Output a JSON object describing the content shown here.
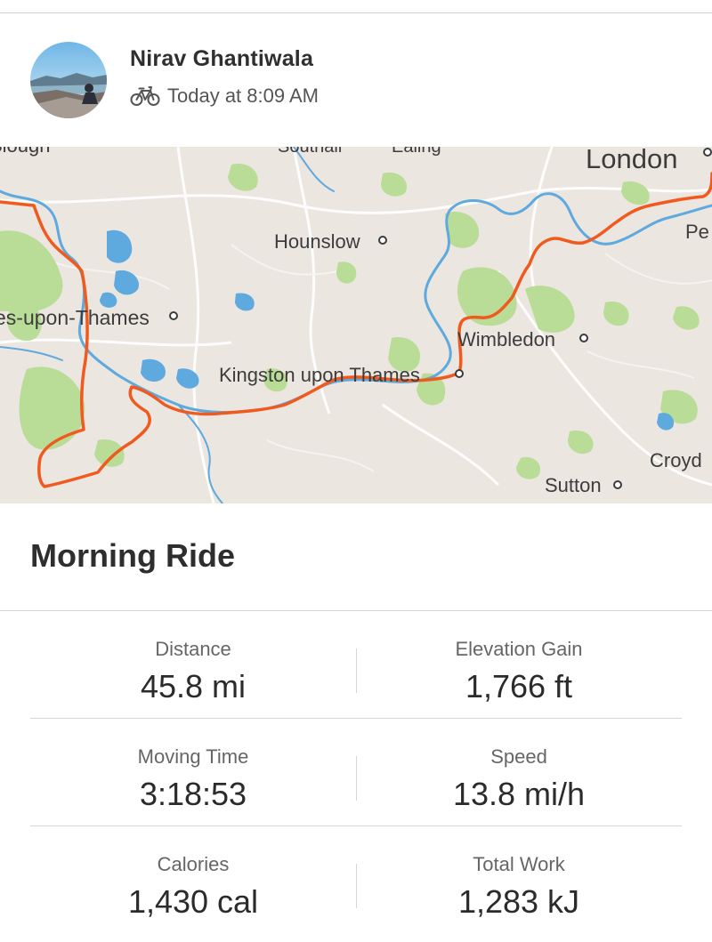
{
  "header": {
    "athlete_name": "Nirav Ghantiwala",
    "activity_icon": "bike-icon",
    "timestamp": "Today at 8:09 AM"
  },
  "map": {
    "place_labels": {
      "slough": "Slough",
      "southall": "Southall",
      "ealing": "Ealing",
      "london": "London",
      "peckham": "Pe",
      "hounslow": "Hounslow",
      "staines": "es-upon-Thames",
      "wimbledon": "Wimbledon",
      "kingston": "Kingston upon Thames",
      "croydon": "Croyd",
      "sutton": "Sutton"
    },
    "colors": {
      "route": "#f05a1e",
      "river": "#5ea9dd",
      "park": "#b9dc97",
      "land": "#ece6e1"
    }
  },
  "activity": {
    "title": "Morning Ride"
  },
  "stats": [
    [
      {
        "label": "Distance",
        "value": "45.8 mi"
      },
      {
        "label": "Elevation Gain",
        "value": "1,766 ft"
      }
    ],
    [
      {
        "label": "Moving Time",
        "value": "3:18:53"
      },
      {
        "label": "Speed",
        "value": "13.8 mi/h"
      }
    ],
    [
      {
        "label": "Calories",
        "value": "1,430 cal"
      },
      {
        "label": "Total Work",
        "value": "1,283 kJ"
      }
    ]
  ]
}
